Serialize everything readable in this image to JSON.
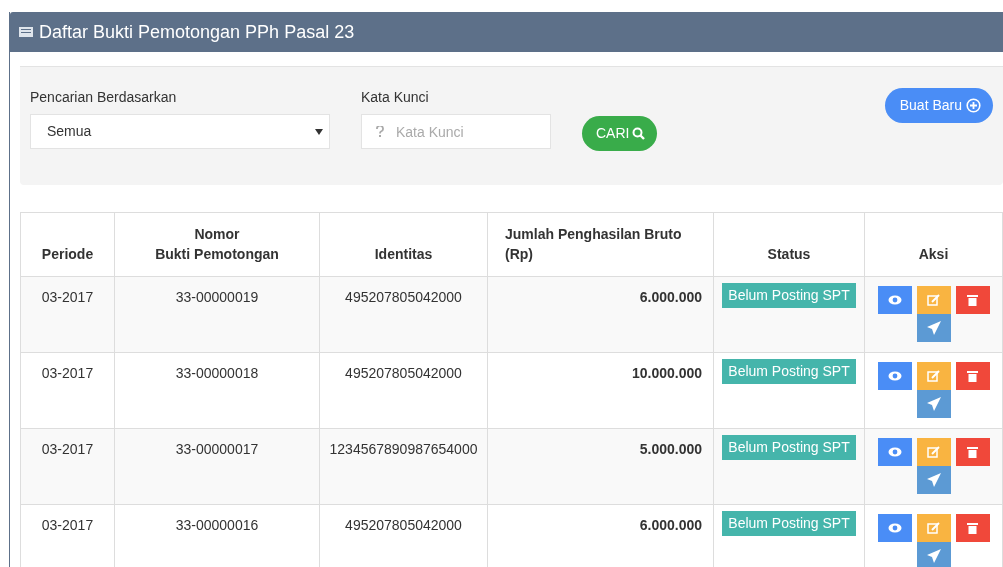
{
  "panel": {
    "title": "Daftar Bukti Pemotongan PPh Pasal 23"
  },
  "filter": {
    "search_by_label": "Pencarian Berdasarkan",
    "search_by_value": "Semua",
    "keyword_label": "Kata Kunci",
    "keyword_placeholder": "Kata Kunci",
    "search_button": "CARI",
    "new_button": "Buat Baru"
  },
  "table": {
    "columns": [
      "Periode",
      "Nomor\nBukti Pemotongan",
      "Identitas",
      "Jumlah Penghasilan Bruto (Rp)",
      "Status",
      "Aksi"
    ],
    "rows": [
      {
        "periode": "03-2017",
        "nomor": "33-00000019",
        "identitas": "495207805042000",
        "jumlah": "6.000.000",
        "status": "Belum Posting SPT"
      },
      {
        "periode": "03-2017",
        "nomor": "33-00000018",
        "identitas": "495207805042000",
        "jumlah": "10.000.000",
        "status": "Belum Posting SPT"
      },
      {
        "periode": "03-2017",
        "nomor": "33-00000017",
        "identitas": "1234567890987654000",
        "jumlah": "5.000.000",
        "status": "Belum Posting SPT"
      },
      {
        "periode": "03-2017",
        "nomor": "33-00000016",
        "identitas": "495207805042000",
        "jumlah": "6.000.000",
        "status": "Belum Posting SPT"
      }
    ]
  }
}
